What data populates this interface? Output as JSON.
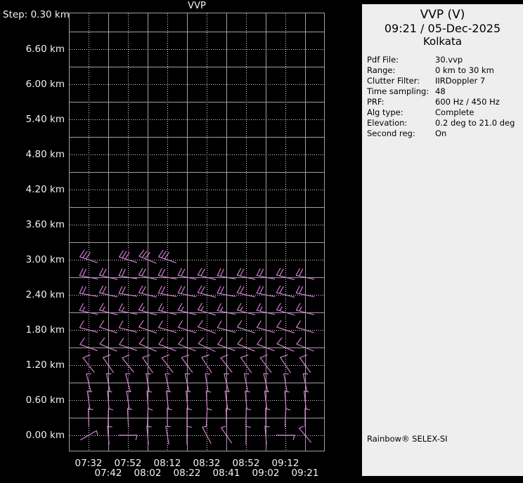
{
  "chart": {
    "title": "VVP",
    "step_label": "Step: 0.30 km"
  },
  "chart_data": {
    "type": "wind_barb_time_height_profile",
    "title": "VVP",
    "step_km": 0.3,
    "y_axis": {
      "unit": "km",
      "labels": [
        "6.60 km",
        "6.00 km",
        "5.40 km",
        "4.80 km",
        "4.20 km",
        "3.60 km",
        "3.00 km",
        "2.40 km",
        "1.80 km",
        "1.20 km",
        "0.60 km",
        "0.00 km"
      ],
      "step_label": "Step: 0.30 km"
    },
    "x_axis": {
      "unit": "time",
      "labels": [
        "07:32",
        "07:42",
        "07:52",
        "08:02",
        "08:12",
        "08:22",
        "08:32",
        "08:41",
        "08:52",
        "09:02",
        "09:12",
        "09:21"
      ]
    },
    "grid": {
      "solid_color": "#9f9f9f",
      "dotted_color": "#dedede",
      "background": "#000000"
    },
    "barb_color": "#d883d8",
    "barb_speed_convention": "full_feather_10kt_half_5kt",
    "barbs": [
      {
        "height_km": 3.0,
        "speed_kt": 30,
        "full": 3,
        "half": 0,
        "dir_deg": 160,
        "cols": [
          0,
          2,
          3,
          4
        ]
      },
      {
        "height_km": 2.7,
        "speed_kt": 20,
        "full": 2,
        "half": 0,
        "dir_deg": 168
      },
      {
        "height_km": 2.4,
        "speed_kt": 20,
        "full": 2,
        "half": 0,
        "dir_deg": 168
      },
      {
        "height_km": 2.1,
        "speed_kt": 15,
        "full": 1,
        "half": 1,
        "dir_deg": 166
      },
      {
        "height_km": 1.8,
        "speed_kt": 10,
        "full": 1,
        "half": 0,
        "dir_deg": 163
      },
      {
        "height_km": 1.5,
        "speed_kt": 10,
        "full": 1,
        "half": 0,
        "dir_deg": 158
      },
      {
        "height_km": 1.2,
        "speed_kt": 10,
        "full": 1,
        "half": 0,
        "dir_deg": 126
      },
      {
        "height_km": 0.9,
        "speed_kt": 5,
        "full": 0,
        "half": 1,
        "dir_deg": 102
      },
      {
        "height_km": 0.6,
        "speed_kt": 5,
        "full": 0,
        "half": 1,
        "dir_deg": 96
      },
      {
        "height_km": 0.3,
        "speed_kt": 5,
        "full": 0,
        "half": 1,
        "dir_deg": 90
      },
      {
        "height_km": 0.0,
        "speed_kt": 5,
        "full": 0,
        "half": 1,
        "dirs_deg": [
          30,
          95,
          0,
          95,
          100,
          90,
          118,
          125,
          90,
          95,
          0,
          130
        ]
      }
    ]
  },
  "panel": {
    "background": "#eeeeee",
    "title_line1": "VVP (V)",
    "title_line2": "09:21 / 05-Dec-2025",
    "title_line3": "Kolkata",
    "info": [
      {
        "label": "Pdf File:",
        "value": "30.vvp"
      },
      {
        "label": "Range:",
        "value": "0 km to 30 km"
      },
      {
        "label": "Clutter Filter:",
        "value": "IIRDoppler 7"
      },
      {
        "label": "Time sampling:",
        "value": "48"
      },
      {
        "label": "PRF:",
        "value": "600 Hz / 450 Hz"
      },
      {
        "label": "Alg type:",
        "value": "Complete"
      },
      {
        "label": "Elevation:",
        "value": "0.2 deg to 21.0 deg"
      },
      {
        "label": "Second reg:",
        "value": "On"
      }
    ],
    "brand": "Rainbow® SELEX-SI"
  }
}
